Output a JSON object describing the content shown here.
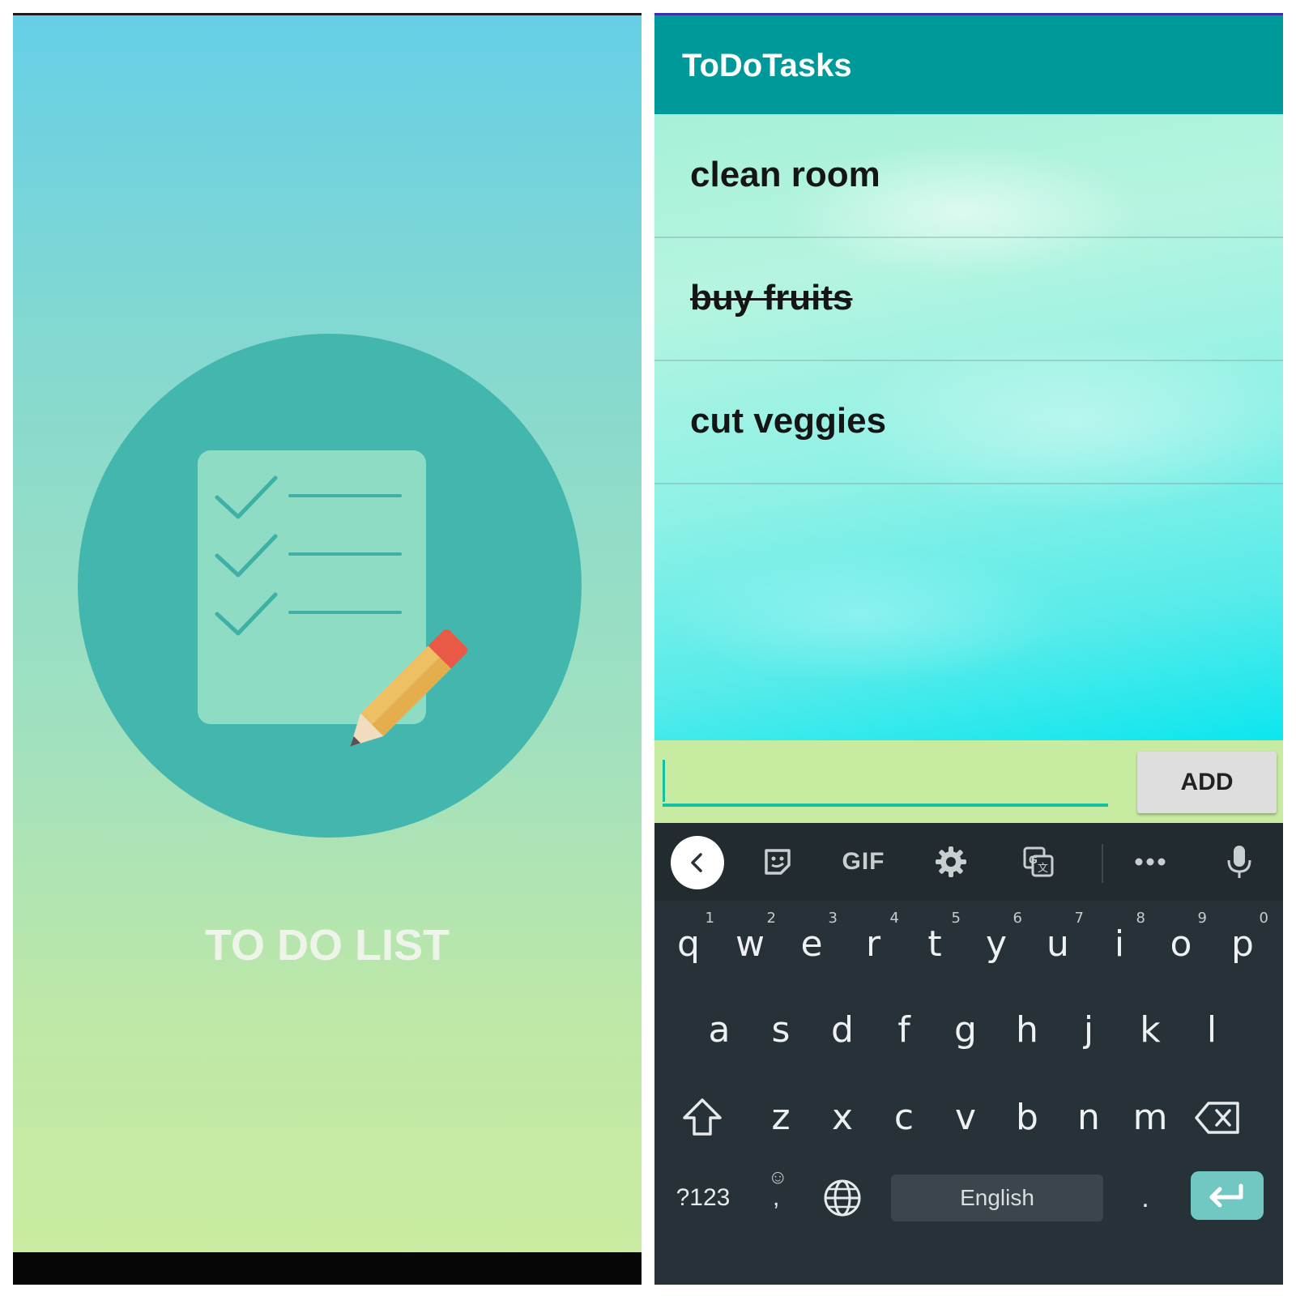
{
  "splash": {
    "title": "TO DO LIST",
    "logo_icon": "checklist-pencil-icon"
  },
  "app": {
    "title": "ToDoTasks",
    "tasks": [
      {
        "text": "clean room",
        "done": false
      },
      {
        "text": "buy fruits",
        "done": true
      },
      {
        "text": "cut veggies",
        "done": false
      }
    ],
    "input": {
      "value": "",
      "placeholder": ""
    },
    "add_label": "ADD"
  },
  "keyboard": {
    "toolbar": {
      "back_icon": "chevron-left-icon",
      "sticker_icon": "sticker-icon",
      "gif_label": "GIF",
      "settings_icon": "gear-icon",
      "translate_icon": "translate-icon",
      "more_icon": "more-icon",
      "mic_icon": "microphone-icon"
    },
    "row1": [
      {
        "key": "q",
        "sup": "1"
      },
      {
        "key": "w",
        "sup": "2"
      },
      {
        "key": "e",
        "sup": "3"
      },
      {
        "key": "r",
        "sup": "4"
      },
      {
        "key": "t",
        "sup": "5"
      },
      {
        "key": "y",
        "sup": "6"
      },
      {
        "key": "u",
        "sup": "7"
      },
      {
        "key": "i",
        "sup": "8"
      },
      {
        "key": "o",
        "sup": "9"
      },
      {
        "key": "p",
        "sup": "0"
      }
    ],
    "row2": [
      "a",
      "s",
      "d",
      "f",
      "g",
      "h",
      "j",
      "k",
      "l"
    ],
    "row3": [
      "z",
      "x",
      "c",
      "v",
      "b",
      "n",
      "m"
    ],
    "symbols_label": "?123",
    "comma_label": ",",
    "space_label": "English",
    "period_label": ".",
    "colors": {
      "accent": "#00999a",
      "enter": "#71c8c3",
      "keyboard_bg": "#263238"
    }
  }
}
